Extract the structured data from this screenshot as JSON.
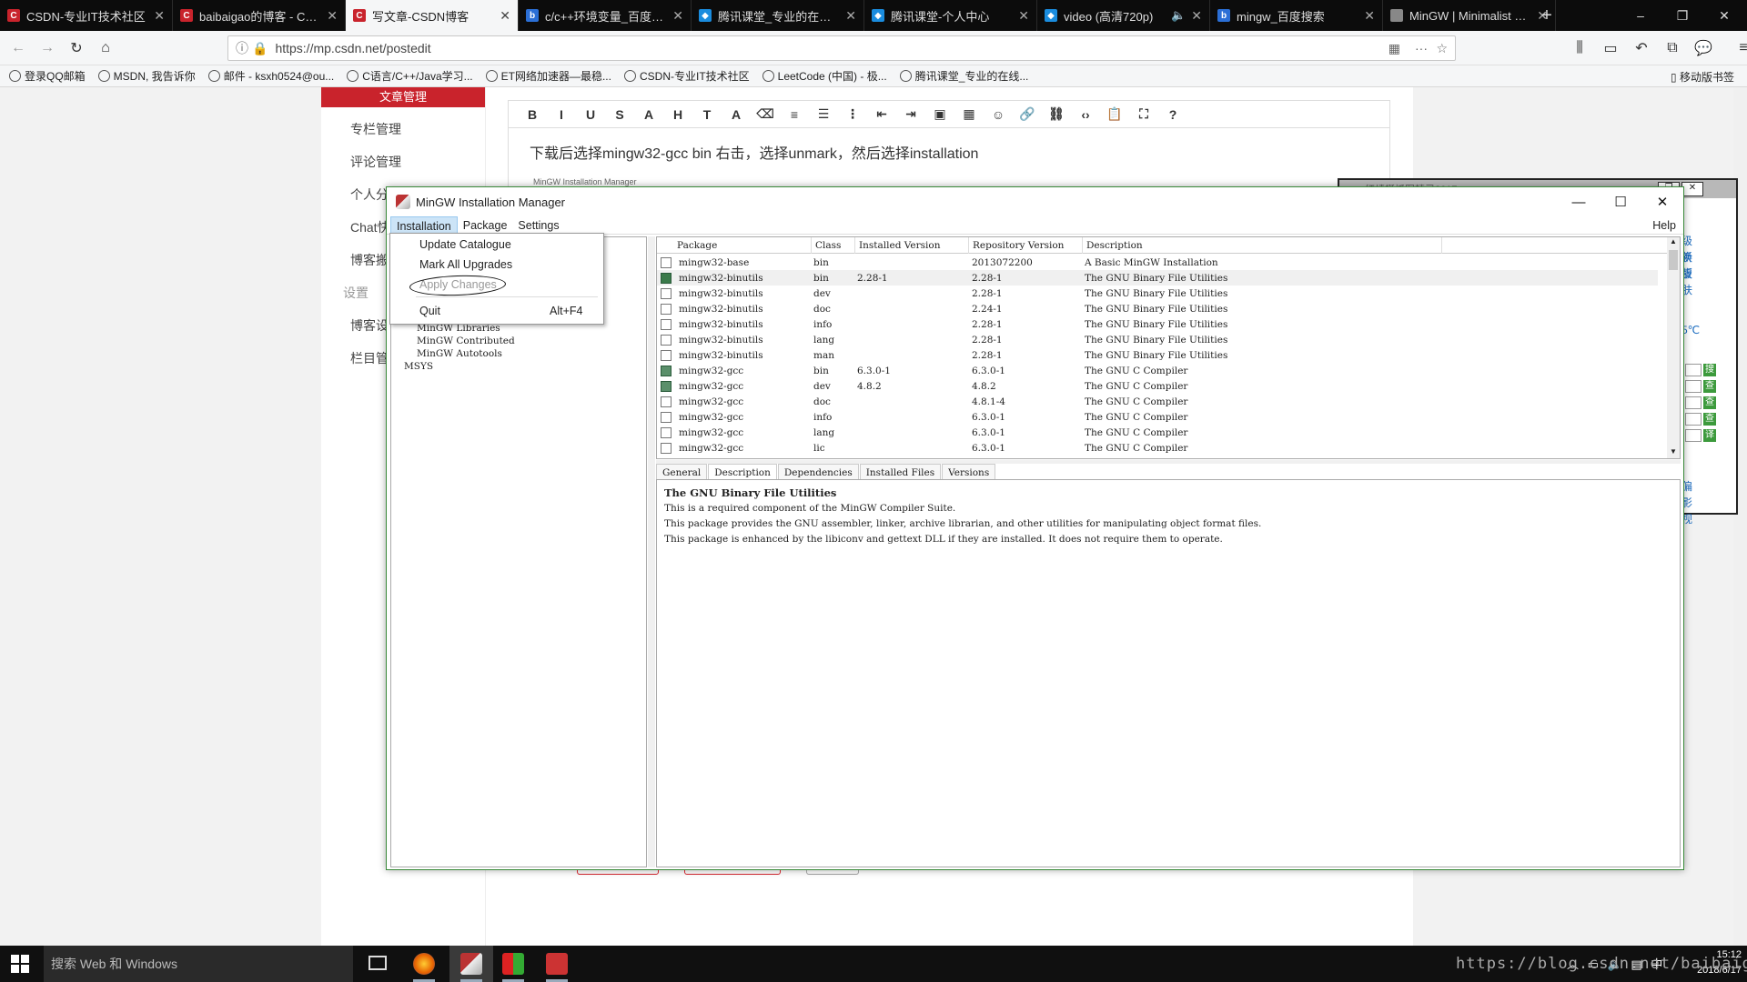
{
  "browser": {
    "tabs": [
      {
        "title": "CSDN-专业IT技术社区",
        "color": "#c9232c",
        "letter": "C"
      },
      {
        "title": "baibaigao的博客 - CSDN",
        "color": "#c9232c",
        "letter": "C"
      },
      {
        "title": "写文章-CSDN博客",
        "color": "#c9232c",
        "letter": "C",
        "active": true
      },
      {
        "title": "c/c++环境变量_百度搜索",
        "color": "#2b6fd6",
        "letter": "b"
      },
      {
        "title": "腾讯课堂_专业的在线教育",
        "color": "#1a8cde",
        "letter": "◆"
      },
      {
        "title": "腾讯课堂-个人中心",
        "color": "#1a8cde",
        "letter": "◆"
      },
      {
        "title": "video (高清720p)",
        "color": "#1a8cde",
        "letter": "◆"
      },
      {
        "title": "mingw_百度搜索",
        "color": "#2b6fd6",
        "letter": "b"
      },
      {
        "title": "MinGW | Minimalist GNU",
        "color": "#888888",
        "letter": ""
      }
    ],
    "url": "https://mp.csdn.net/postedit",
    "bookmarks": [
      "登录QQ邮箱",
      "MSDN, 我告诉你",
      "邮件 - ksxh0524@ou...",
      "C语言/C++/Java学习...",
      "ET网络加速器—最稳...",
      "CSDN-专业IT技术社区",
      "LeetCode (中国) - 极...",
      "腾讯课堂_专业的在线..."
    ],
    "mobile_bookmarks": "移动版书签"
  },
  "sidebar": {
    "active": "文章管理",
    "items": [
      "专栏管理",
      "评论管理",
      "个人分",
      "Chat快",
      "博客搬",
      "设置",
      "博客设",
      "栏目管"
    ]
  },
  "editor": {
    "text": "下载后选择mingw32-gcc bin 右击，选择unmark，然后选择installation",
    "thumb_label": "MinGW Installation Manager"
  },
  "right_panel": {
    "title": "红蜻蜓抓图精灵2017",
    "links": [
      "级新版",
      "换皮肤",
      "5℃",
      "偏影视"
    ],
    "buttons": [
      "搜",
      "查",
      "查",
      "查",
      "译"
    ]
  },
  "mingw": {
    "title": "MinGW Installation Manager",
    "menu": [
      "Installation",
      "Package",
      "Settings"
    ],
    "help": "Help",
    "dropdown": {
      "items": [
        "Update Catalogue",
        "Mark All Upgrades",
        "Apply Changes",
        "Quit"
      ],
      "quit_shortcut": "Alt+F4"
    },
    "tree": [
      "MinGW Libraries",
      "MinGW Contributed",
      "MinGW Autotools",
      "MSYS"
    ],
    "columns": [
      "Package",
      "Class",
      "Installed Version",
      "Repository Version",
      "Description"
    ],
    "packages": [
      {
        "name": "mingw32-base",
        "class": "bin",
        "installed": "",
        "repo": "2013072200",
        "desc": "A Basic MinGW Installation",
        "state": "none"
      },
      {
        "name": "mingw32-binutils",
        "class": "bin",
        "installed": "2.28-1",
        "repo": "2.28-1",
        "desc": "The GNU Binary File Utilities",
        "state": "installed",
        "selected": true
      },
      {
        "name": "mingw32-binutils",
        "class": "dev",
        "installed": "",
        "repo": "2.28-1",
        "desc": "The GNU Binary File Utilities",
        "state": "none"
      },
      {
        "name": "mingw32-binutils",
        "class": "doc",
        "installed": "",
        "repo": "2.24-1",
        "desc": "The GNU Binary File Utilities",
        "state": "none"
      },
      {
        "name": "mingw32-binutils",
        "class": "info",
        "installed": "",
        "repo": "2.28-1",
        "desc": "The GNU Binary File Utilities",
        "state": "none"
      },
      {
        "name": "mingw32-binutils",
        "class": "lang",
        "installed": "",
        "repo": "2.28-1",
        "desc": "The GNU Binary File Utilities",
        "state": "none"
      },
      {
        "name": "mingw32-binutils",
        "class": "man",
        "installed": "",
        "repo": "2.28-1",
        "desc": "The GNU Binary File Utilities",
        "state": "none"
      },
      {
        "name": "mingw32-gcc",
        "class": "bin",
        "installed": "6.3.0-1",
        "repo": "6.3.0-1",
        "desc": "The GNU C Compiler",
        "state": "installed2"
      },
      {
        "name": "mingw32-gcc",
        "class": "dev",
        "installed": "4.8.2",
        "repo": "4.8.2",
        "desc": "The GNU C Compiler",
        "state": "installed2"
      },
      {
        "name": "mingw32-gcc",
        "class": "doc",
        "installed": "",
        "repo": "4.8.1-4",
        "desc": "The GNU C Compiler",
        "state": "none"
      },
      {
        "name": "mingw32-gcc",
        "class": "info",
        "installed": "",
        "repo": "6.3.0-1",
        "desc": "The GNU C Compiler",
        "state": "none"
      },
      {
        "name": "mingw32-gcc",
        "class": "lang",
        "installed": "",
        "repo": "6.3.0-1",
        "desc": "The GNU C Compiler",
        "state": "none"
      },
      {
        "name": "mingw32-gcc",
        "class": "lic",
        "installed": "",
        "repo": "6.3.0-1",
        "desc": "The GNU C Compiler",
        "state": "none"
      }
    ],
    "detail_tabs": [
      "General",
      "Description",
      "Dependencies",
      "Installed Files",
      "Versions"
    ],
    "active_detail_tab": "Description",
    "description": {
      "heading": "The GNU Binary File Utilities",
      "lines": [
        "This is a required component of the MinGW Compiler Suite.",
        "This package provides the GNU assembler, linker, archive librarian, and other utilities for manipulating object format files.",
        "This package is enhanced by the libiconv and gettext DLL if they are installed. It does not require them to operate."
      ]
    }
  },
  "taskbar": {
    "search_placeholder": "搜索 Web 和 Windows",
    "time": "15:12",
    "date": "2018/6/17",
    "ime": "中",
    "watermark": "https://blog.csdn.net/baibaigao"
  },
  "colors": {
    "csdn_red": "#c9232c",
    "mingw_border": "#3a8a3a",
    "installed_box": "#3a7a4a"
  }
}
